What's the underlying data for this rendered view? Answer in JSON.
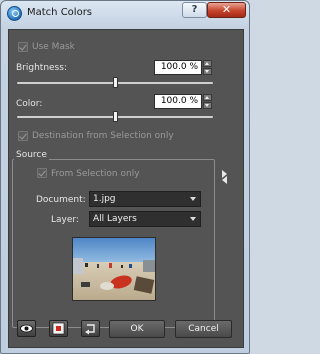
{
  "window": {
    "title": "Match Colors",
    "help_label": "?",
    "close_label": "✕"
  },
  "options": {
    "use_mask_label": "Use Mask",
    "use_mask_checked": true,
    "brightness_label": "Brightness:",
    "brightness_value": "100.0 %",
    "brightness_slider": 0.5,
    "color_label": "Color:",
    "color_value": "100.0 %",
    "color_slider": 0.5,
    "destination_label": "Destination from Selection only",
    "destination_checked": true
  },
  "source": {
    "group_title": "Source",
    "from_selection_label": "From Selection only",
    "from_selection_checked": true,
    "document_label": "Document:",
    "document_value": "1.jpg",
    "layer_label": "Layer:",
    "layer_value": "All Layers"
  },
  "footer": {
    "ok_label": "OK",
    "cancel_label": "Cancel",
    "icons": [
      "eye-icon",
      "swap-colors-icon",
      "reset-icon"
    ]
  },
  "colors": {
    "panel": "#545454",
    "window_frame": "#c4d2e2",
    "close_red": "#c6442d"
  }
}
